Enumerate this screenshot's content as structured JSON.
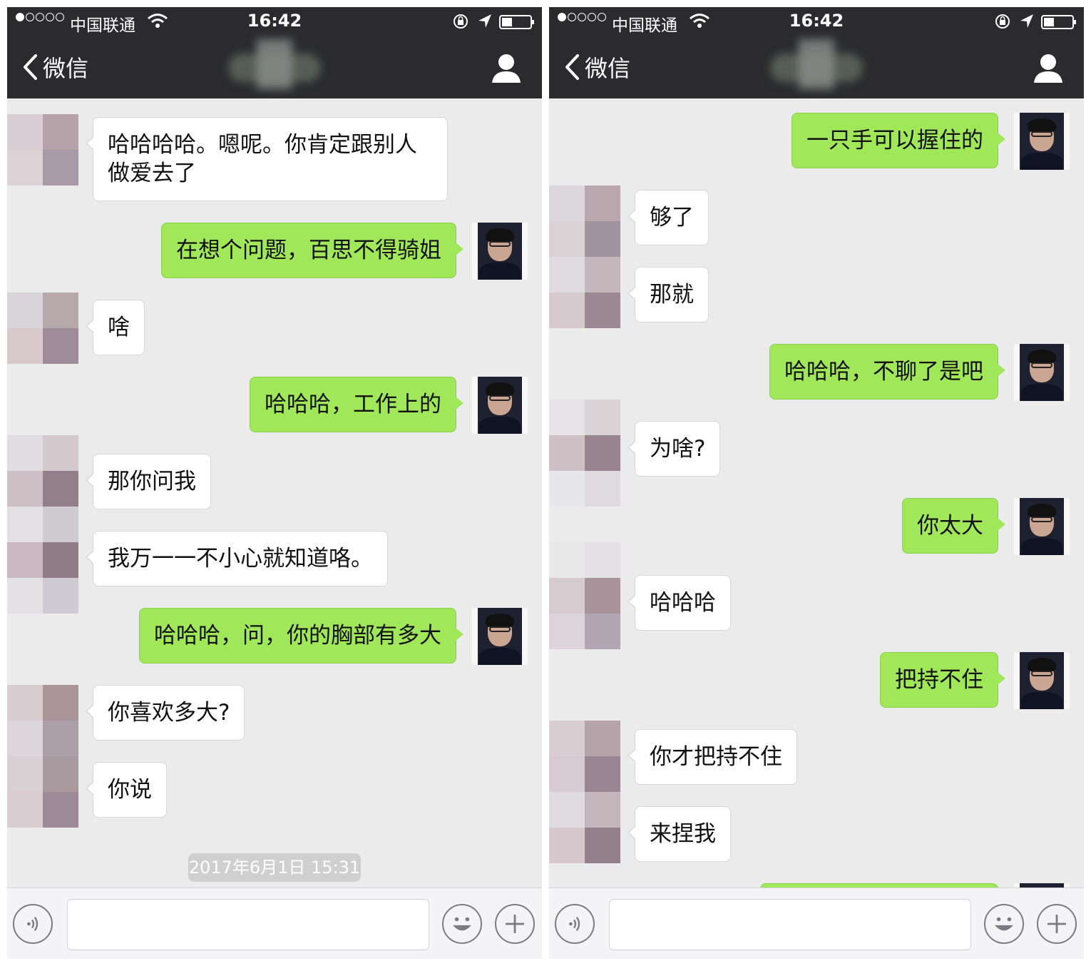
{
  "left": {
    "status": {
      "carrier": "中国联通",
      "time": "16:42"
    },
    "header": {
      "back_label": "微信"
    },
    "messages": [
      {
        "side": "recv",
        "text": "哈哈哈哈。嗯呢。你肯定跟别人做爱去了"
      },
      {
        "side": "sent",
        "text": "在想个问题，百思不得骑姐"
      },
      {
        "side": "recv",
        "text": "啥"
      },
      {
        "side": "sent",
        "text": "哈哈哈，工作上的"
      },
      {
        "side": "recv",
        "text": "那你问我"
      },
      {
        "side": "recv",
        "text": "我万一一不小心就知道咯。"
      },
      {
        "side": "sent",
        "text": "哈哈哈，问，你的胸部有多大"
      },
      {
        "side": "recv",
        "text": "你喜欢多大?"
      },
      {
        "side": "recv",
        "text": "你说"
      }
    ],
    "timestamp": "2017年6月1日 15:31"
  },
  "right": {
    "status": {
      "carrier": "中国联通",
      "time": "16:42"
    },
    "header": {
      "back_label": "微信"
    },
    "messages": [
      {
        "side": "sent",
        "text": "一只手可以握住的"
      },
      {
        "side": "recv",
        "text": "够了"
      },
      {
        "side": "recv",
        "text": "那就"
      },
      {
        "side": "sent",
        "text": "哈哈哈，不聊了是吧"
      },
      {
        "side": "recv",
        "text": "为啥?"
      },
      {
        "side": "sent",
        "text": "你太大"
      },
      {
        "side": "recv",
        "text": "哈哈哈"
      },
      {
        "side": "sent",
        "text": "把持不住"
      },
      {
        "side": "recv",
        "text": "你才把持不住"
      },
      {
        "side": "recv",
        "text": "来捏我"
      }
    ]
  },
  "theme": {
    "header_bg": "#2b2b2d",
    "chat_bg": "#ebebeb",
    "sent_bubble": "#a0e75a",
    "recv_bubble": "#ffffff"
  },
  "icons": [
    "wifi-icon",
    "rotation-lock-icon",
    "location-icon",
    "battery-icon",
    "back-chevron-icon",
    "profile-icon",
    "voice-icon",
    "emoji-icon",
    "plus-icon"
  ]
}
